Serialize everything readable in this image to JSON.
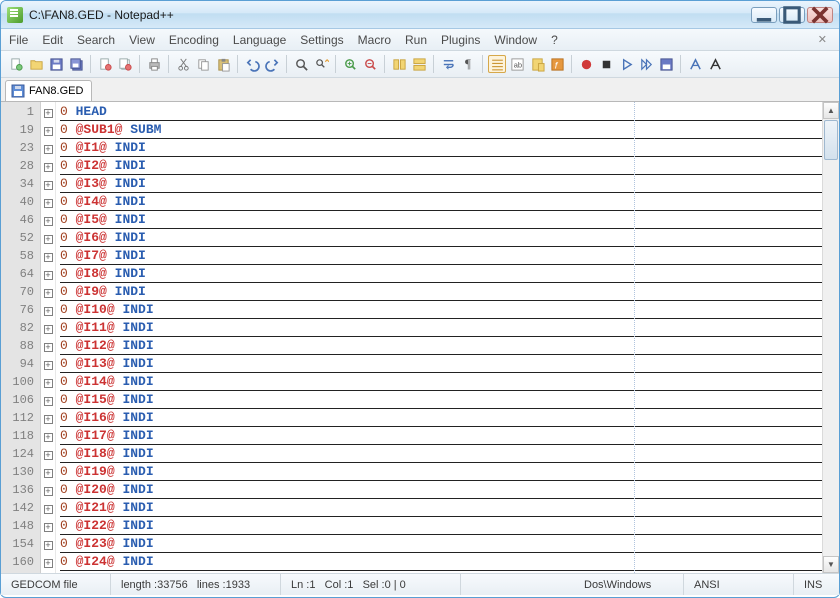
{
  "window": {
    "title": "C:\\FAN8.GED - Notepad++"
  },
  "menu": {
    "items": [
      "File",
      "Edit",
      "Search",
      "View",
      "Encoding",
      "Language",
      "Settings",
      "Macro",
      "Run",
      "Plugins",
      "Window",
      "?"
    ]
  },
  "tab": {
    "label": "FAN8.GED"
  },
  "lines": [
    {
      "num": 1,
      "level": "0",
      "tag": "",
      "kw": "HEAD"
    },
    {
      "num": 19,
      "level": "0",
      "tag": "@SUB1@",
      "kw": "SUBM"
    },
    {
      "num": 23,
      "level": "0",
      "tag": "@I1@",
      "kw": "INDI"
    },
    {
      "num": 28,
      "level": "0",
      "tag": "@I2@",
      "kw": "INDI"
    },
    {
      "num": 34,
      "level": "0",
      "tag": "@I3@",
      "kw": "INDI"
    },
    {
      "num": 40,
      "level": "0",
      "tag": "@I4@",
      "kw": "INDI"
    },
    {
      "num": 46,
      "level": "0",
      "tag": "@I5@",
      "kw": "INDI"
    },
    {
      "num": 52,
      "level": "0",
      "tag": "@I6@",
      "kw": "INDI"
    },
    {
      "num": 58,
      "level": "0",
      "tag": "@I7@",
      "kw": "INDI"
    },
    {
      "num": 64,
      "level": "0",
      "tag": "@I8@",
      "kw": "INDI"
    },
    {
      "num": 70,
      "level": "0",
      "tag": "@I9@",
      "kw": "INDI"
    },
    {
      "num": 76,
      "level": "0",
      "tag": "@I10@",
      "kw": "INDI"
    },
    {
      "num": 82,
      "level": "0",
      "tag": "@I11@",
      "kw": "INDI"
    },
    {
      "num": 88,
      "level": "0",
      "tag": "@I12@",
      "kw": "INDI"
    },
    {
      "num": 94,
      "level": "0",
      "tag": "@I13@",
      "kw": "INDI"
    },
    {
      "num": 100,
      "level": "0",
      "tag": "@I14@",
      "kw": "INDI"
    },
    {
      "num": 106,
      "level": "0",
      "tag": "@I15@",
      "kw": "INDI"
    },
    {
      "num": 112,
      "level": "0",
      "tag": "@I16@",
      "kw": "INDI"
    },
    {
      "num": 118,
      "level": "0",
      "tag": "@I17@",
      "kw": "INDI"
    },
    {
      "num": 124,
      "level": "0",
      "tag": "@I18@",
      "kw": "INDI"
    },
    {
      "num": 130,
      "level": "0",
      "tag": "@I19@",
      "kw": "INDI"
    },
    {
      "num": 136,
      "level": "0",
      "tag": "@I20@",
      "kw": "INDI"
    },
    {
      "num": 142,
      "level": "0",
      "tag": "@I21@",
      "kw": "INDI"
    },
    {
      "num": 148,
      "level": "0",
      "tag": "@I22@",
      "kw": "INDI"
    },
    {
      "num": 154,
      "level": "0",
      "tag": "@I23@",
      "kw": "INDI"
    },
    {
      "num": 160,
      "level": "0",
      "tag": "@I24@",
      "kw": "INDI"
    }
  ],
  "status": {
    "filetype": "GEDCOM file",
    "length_label": "length : ",
    "length": "33756",
    "lines_label": "lines : ",
    "lines": "1933",
    "ln_label": "Ln : ",
    "ln": "1",
    "col_label": "Col : ",
    "col": "1",
    "sel_label": "Sel : ",
    "sel": "0 | 0",
    "eol": "Dos\\Windows",
    "encoding": "ANSI",
    "insmode": "INS"
  }
}
